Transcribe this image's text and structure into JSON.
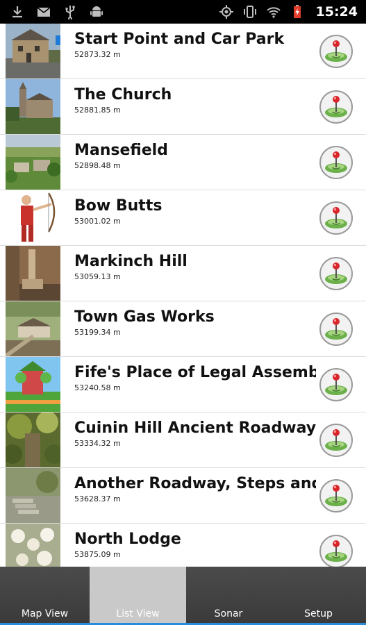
{
  "status_bar": {
    "time": "15:24",
    "left_icons": [
      "download-icon",
      "gmail-icon",
      "usb-icon",
      "android-icon"
    ],
    "right_icons": [
      "gps-icon",
      "vibrate-icon",
      "wifi-icon",
      "battery-charging-icon"
    ]
  },
  "list": {
    "items": [
      {
        "title": "Start Point and Car Park",
        "distance": "52873.32 m",
        "thumb": "building"
      },
      {
        "title": "The Church",
        "distance": "52881.85 m",
        "thumb": "church"
      },
      {
        "title": "Mansefield",
        "distance": "52898.48 m",
        "thumb": "village"
      },
      {
        "title": "Bow Butts",
        "distance": "53001.02 m",
        "thumb": "archer"
      },
      {
        "title": "Markinch Hill",
        "distance": "53059.13 m",
        "thumb": "monument"
      },
      {
        "title": "Town Gas Works",
        "distance": "53199.34 m",
        "thumb": "town"
      },
      {
        "title": "Fife's Place of Legal Assembly &",
        "distance": "53240.58 m",
        "thumb": "castle"
      },
      {
        "title": "Cuinin Hill Ancient Roadway to",
        "distance": "53334.32 m",
        "thumb": "forest"
      },
      {
        "title": "Another Roadway, Steps and B",
        "distance": "53628.37 m",
        "thumb": "steps"
      },
      {
        "title": "North Lodge",
        "distance": "53875.09 m",
        "thumb": "flowers"
      }
    ]
  },
  "tabs": [
    {
      "label": "Map View",
      "selected": false
    },
    {
      "label": "List View",
      "selected": true
    },
    {
      "label": "Sonar",
      "selected": false
    },
    {
      "label": "Setup",
      "selected": false
    }
  ],
  "colors": {
    "accent": "#2a8bd8",
    "tab_bg": "#404040",
    "tab_selected": "#c9c9c9",
    "pin_red": "#d8262b",
    "pin_green": "#5aa53a"
  }
}
